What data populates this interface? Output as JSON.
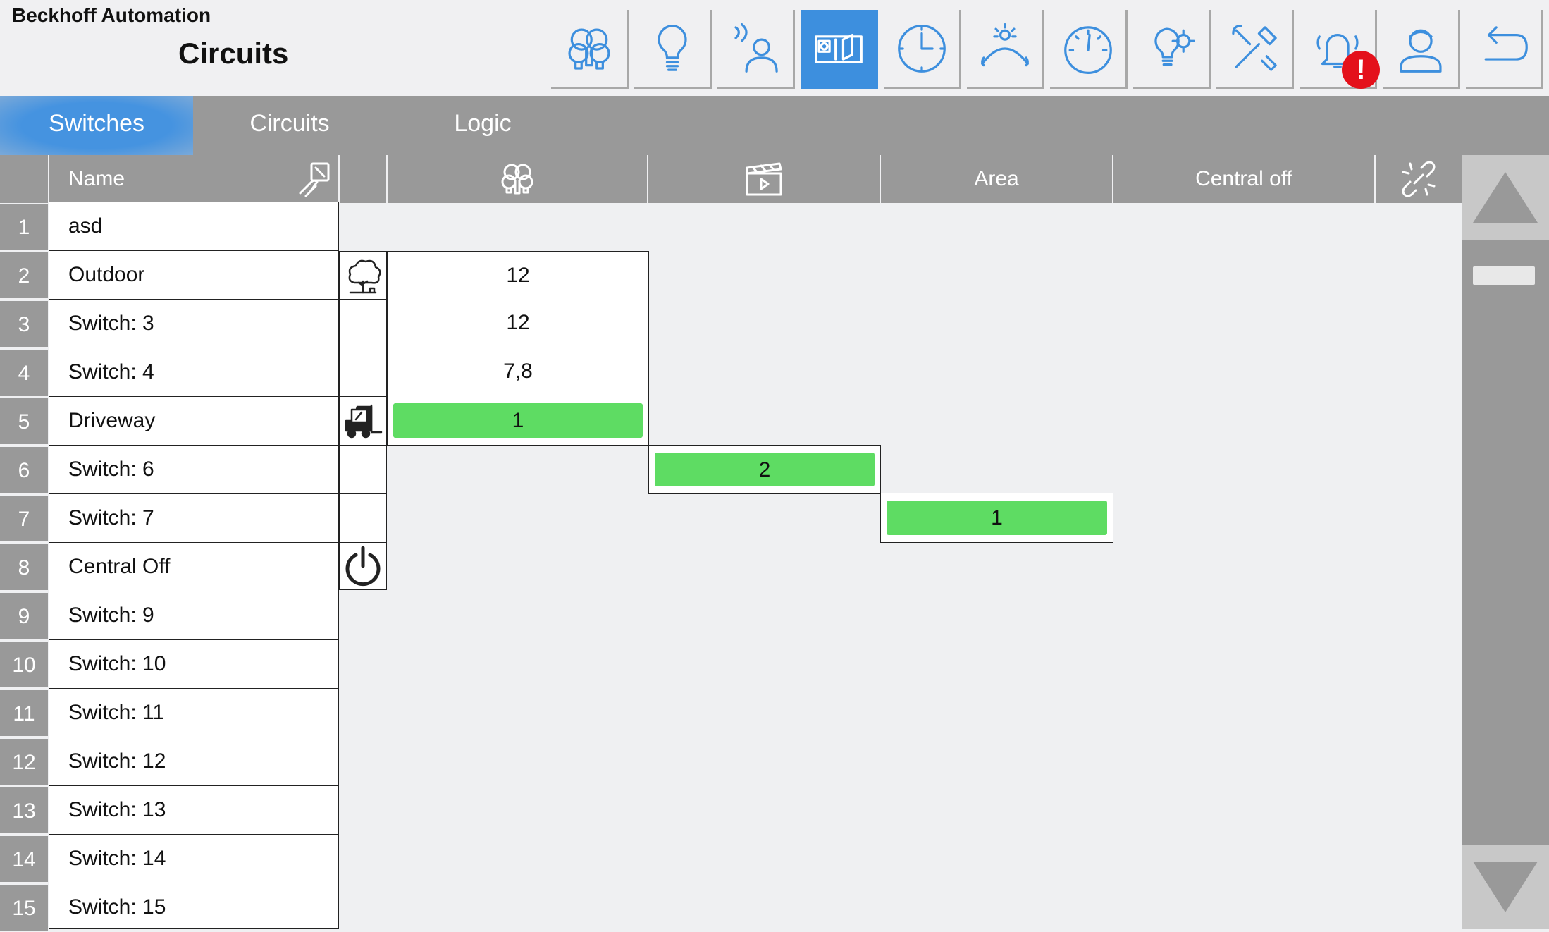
{
  "header": {
    "brand": "Beckhoff Automation",
    "title": "Circuits",
    "toolbar": [
      {
        "name": "lighting-scenes-icon"
      },
      {
        "name": "lightbulb-icon"
      },
      {
        "name": "presence-sensor-icon"
      },
      {
        "name": "circuits-panel-icon",
        "active": true
      },
      {
        "name": "clock-icon"
      },
      {
        "name": "daylight-icon"
      },
      {
        "name": "gauge-icon"
      },
      {
        "name": "bulb-gear-icon"
      },
      {
        "name": "tools-icon"
      },
      {
        "name": "alarm-bell-icon",
        "badge": "!"
      },
      {
        "name": "user-icon"
      },
      {
        "name": "back-arrow-icon"
      }
    ]
  },
  "tabs": [
    {
      "label": "Switches",
      "active": true
    },
    {
      "label": "Circuits",
      "active": false
    },
    {
      "label": "Logic",
      "active": false
    }
  ],
  "table": {
    "headers": {
      "name": "Name",
      "area": "Area",
      "central_off": "Central off"
    },
    "header_icons": [
      "touch-switch-icon",
      "bulb-group-icon",
      "scene-clapper-icon",
      "unlink-icon"
    ],
    "rows": [
      {
        "num": "1",
        "name": "asd"
      },
      {
        "num": "2",
        "name": "Outdoor",
        "icon": "tree-icon",
        "circuits": "12"
      },
      {
        "num": "3",
        "name": "Switch: 3",
        "circuits": "12"
      },
      {
        "num": "4",
        "name": "Switch: 4",
        "circuits": "7,8"
      },
      {
        "num": "5",
        "name": "Driveway",
        "icon": "forklift-icon",
        "circuits": "1",
        "circuits_active": true
      },
      {
        "num": "6",
        "name": "Switch: 6",
        "scene": "2",
        "scene_active": true
      },
      {
        "num": "7",
        "name": "Switch: 7",
        "area": "1",
        "area_active": true
      },
      {
        "num": "8",
        "name": "Central Off",
        "icon": "power-icon"
      },
      {
        "num": "9",
        "name": "Switch: 9"
      },
      {
        "num": "10",
        "name": "Switch: 10"
      },
      {
        "num": "11",
        "name": "Switch: 11"
      },
      {
        "num": "12",
        "name": "Switch: 12"
      },
      {
        "num": "13",
        "name": "Switch: 13"
      },
      {
        "num": "14",
        "name": "Switch: 14"
      },
      {
        "num": "15",
        "name": "Switch: 15"
      }
    ]
  },
  "colors": {
    "accent": "#3d8fde",
    "active_value": "#5edc63",
    "header_gray": "#999999",
    "alarm": "#e4111b"
  }
}
